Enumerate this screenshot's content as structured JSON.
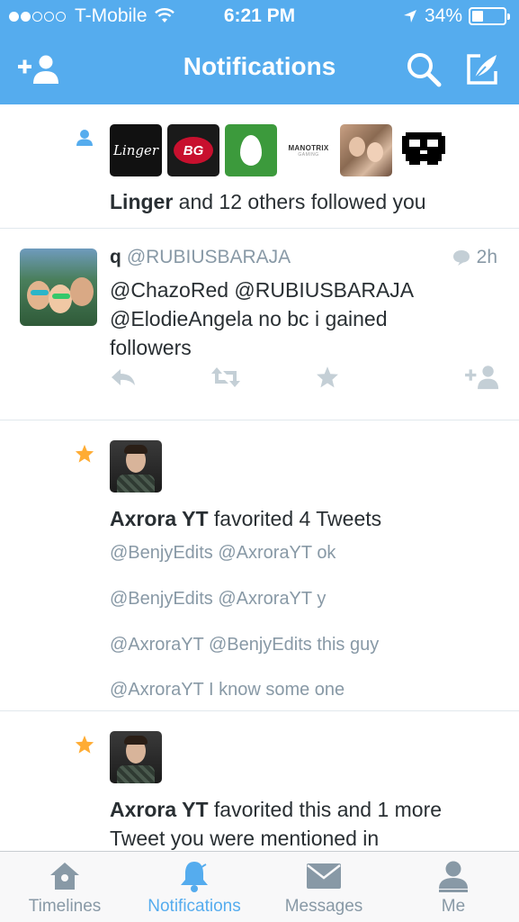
{
  "status_bar": {
    "carrier": "T-Mobile",
    "time": "6:21 PM",
    "battery_percent": "34%",
    "battery_level": 0.34,
    "signal_bars_filled": 2,
    "signal_bars_total": 5
  },
  "nav": {
    "title": "Notifications",
    "left_icon": "add-user-icon",
    "right_icons": [
      "search-icon",
      "compose-icon"
    ]
  },
  "colors": {
    "brand_blue": "#55acee",
    "star_orange": "#ffac33",
    "muted_gray": "#8899a6",
    "text_dark": "#292f33"
  },
  "notifications": [
    {
      "type": "follow",
      "icon": "person-icon",
      "avatars": [
        {
          "label": "Linger"
        },
        {
          "label": "BG"
        },
        {
          "label": ""
        },
        {
          "label": "MANOTRIX",
          "sublabel": "GAMING"
        },
        {
          "label": ""
        },
        {
          "label": ""
        }
      ],
      "actor": "Linger",
      "text": " and 12 others followed you"
    },
    {
      "type": "mention",
      "name": "q",
      "handle": "@RUBIUSBARAJA",
      "time": "2h",
      "text_lines": [
        "@ChazoRed @RUBIUSBARAJA",
        "@ElodieAngela no bc i gained",
        "followers"
      ],
      "actions": [
        "reply-icon",
        "retweet-icon",
        "favorite-icon",
        "follow-icon"
      ]
    },
    {
      "type": "favorite",
      "icon": "star-icon",
      "actor": "Axrora YT",
      "text": " favorited 4 Tweets",
      "tweets": [
        "@BenjyEdits @AxroraYT ok",
        "@BenjyEdits @AxroraYT y",
        "@AxroraYT @BenjyEdits this guy",
        "@AxroraYT I know some one"
      ]
    },
    {
      "type": "favorite",
      "icon": "star-icon",
      "actor": "Axrora YT",
      "text_line1": " favorited this and 1 more",
      "text_line2": "Tweet you were mentioned in"
    }
  ],
  "tabs": [
    {
      "label": "Timelines",
      "icon": "home-icon",
      "active": false
    },
    {
      "label": "Notifications",
      "icon": "bell-icon",
      "active": true
    },
    {
      "label": "Messages",
      "icon": "envelope-icon",
      "active": false
    },
    {
      "label": "Me",
      "icon": "profile-icon",
      "active": false
    }
  ]
}
